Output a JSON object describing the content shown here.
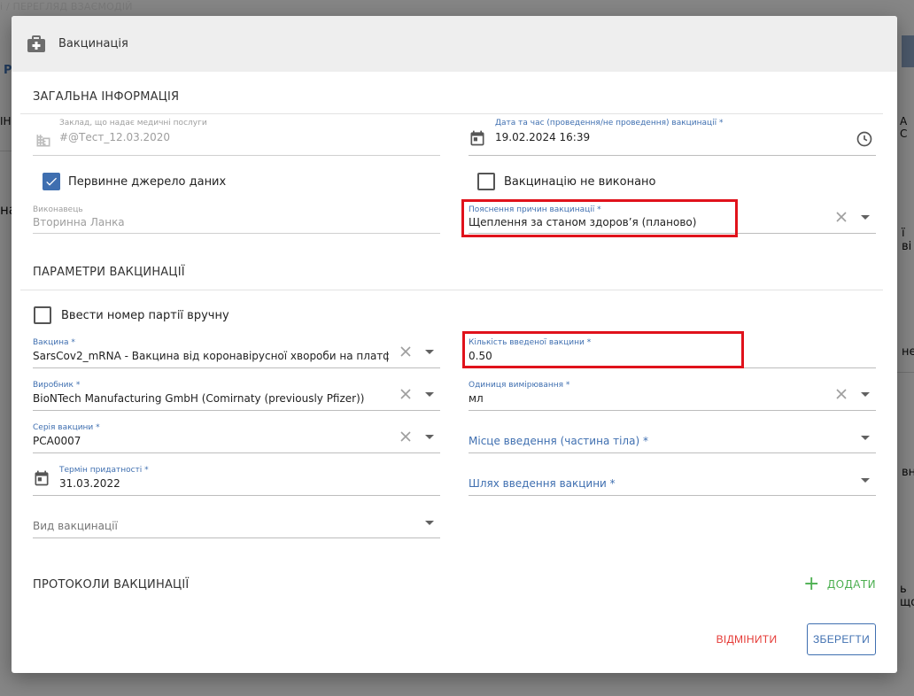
{
  "background": {
    "breadcrumb": "і / ПЕРЕГЛЯД ВЗАЄМОДІЙ",
    "fragments": [
      "Р",
      "ІН",
      "на",
      "ї ві",
      "нен",
      "вн",
      "А С",
      "ь що"
    ]
  },
  "dialog": {
    "title": "Вакцинація",
    "sections": {
      "general": "ЗАГАЛЬНА ІНФОРМАЦІЯ",
      "params": "ПАРАМЕТРИ ВАКЦИНАЦІЇ",
      "protocols": "ПРОТОКОЛИ ВАКЦИНАЦІЇ"
    },
    "facility": {
      "label": "Заклад, що надає медичні послуги",
      "value": "#@Тест_12.03.2020"
    },
    "datetime": {
      "label": "Дата та час (проведення/не проведення) вакцинації *",
      "value": "19.02.2024 16:39"
    },
    "primary_source": {
      "label": "Первинне джерело даних",
      "checked": true
    },
    "not_performed": {
      "label": "Вакцинацію не виконано",
      "checked": false
    },
    "performer": {
      "label": "Виконавець",
      "value": "Вторинна Ланка"
    },
    "reason": {
      "label": "Пояснення причин вакцинації *",
      "value": "Щеплення за станом здоров’я (планово)"
    },
    "manual_batch": {
      "label": "Ввести номер партії вручну",
      "checked": false
    },
    "vaccine": {
      "label": "Вакцина *",
      "value": "SarsCov2_mRNA - Вакцина від коронавірусної хвороби на платф"
    },
    "dose_quantity": {
      "label": "Кількість введеної вакцини *",
      "value": "0.50"
    },
    "manufacturer": {
      "label": "Виробник *",
      "value": "BioNTech Manufacturing GmbH (Comirnaty (previously Pfizer))"
    },
    "unit": {
      "label": "Одиниця вимірювання *",
      "value": "мл"
    },
    "lot": {
      "label": "Серія вакцини *",
      "value": "PCA0007"
    },
    "site": {
      "placeholder": "Місце введення (частина тіла) *"
    },
    "expiry": {
      "label": "Термін придатності *",
      "value": "31.03.2022"
    },
    "route": {
      "placeholder": "Шлях введення вакцини *"
    },
    "vaccination_type": {
      "placeholder": "Вид вакцинації"
    },
    "add_label": "ДОДАТИ",
    "cancel_label": "ВІДМІНИТИ",
    "save_label": "ЗБЕРЕГТИ"
  },
  "colors": {
    "accent": "#3f6fb0",
    "add": "#4caf50",
    "cancel": "#e53935",
    "highlight": "#e0121b"
  },
  "icons": [
    "medical-kit-icon",
    "building-icon",
    "calendar-icon",
    "clock-icon",
    "check-icon",
    "clear-icon",
    "dropdown-arrow-icon",
    "plus-icon"
  ]
}
